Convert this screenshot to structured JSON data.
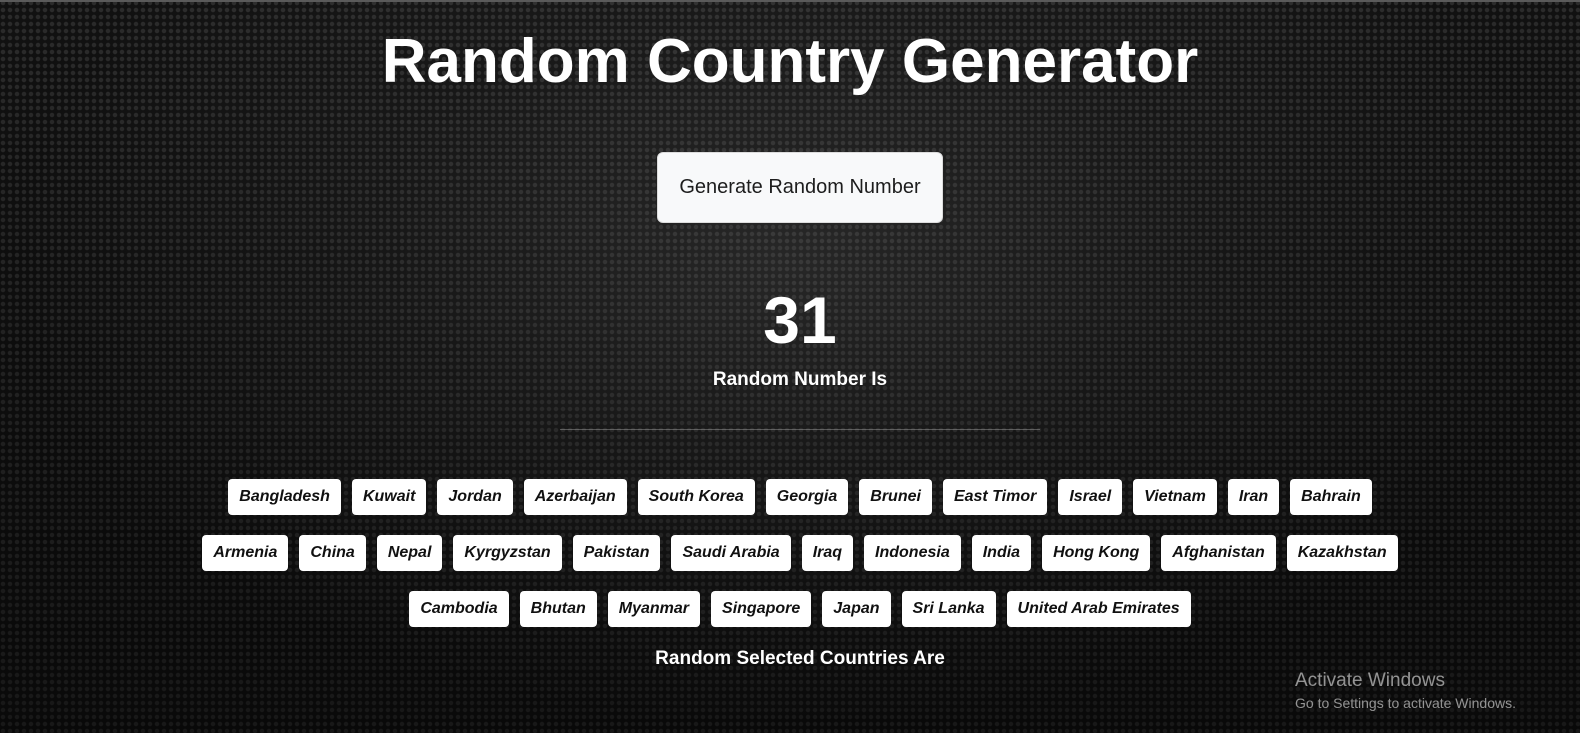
{
  "page": {
    "title": "Random Country Generator",
    "background_color": "#111111"
  },
  "generator": {
    "button_label": "Generate Random Number",
    "number": "31",
    "number_label": "Random Number Is"
  },
  "countries": {
    "items": [
      "Bangladesh",
      "Kuwait",
      "Jordan",
      "Azerbaijan",
      "South Korea",
      "Georgia",
      "Brunei",
      "East Timor",
      "Israel",
      "Vietnam",
      "Iran",
      "Bahrain",
      "Armenia",
      "China",
      "Nepal",
      "Kyrgyzstan",
      "Pakistan",
      "Saudi Arabia",
      "Iraq",
      "Indonesia",
      "India",
      "Hong Kong",
      "Afghanistan",
      "Kazakhstan",
      "Cambodia",
      "Bhutan",
      "Myanmar",
      "Singapore",
      "Japan",
      "Sri Lanka",
      "United Arab Emirates"
    ],
    "label": "Random Selected Countries Are"
  },
  "watermark": {
    "title": "Activate Windows",
    "subtitle": "Go to Settings to activate Windows."
  }
}
